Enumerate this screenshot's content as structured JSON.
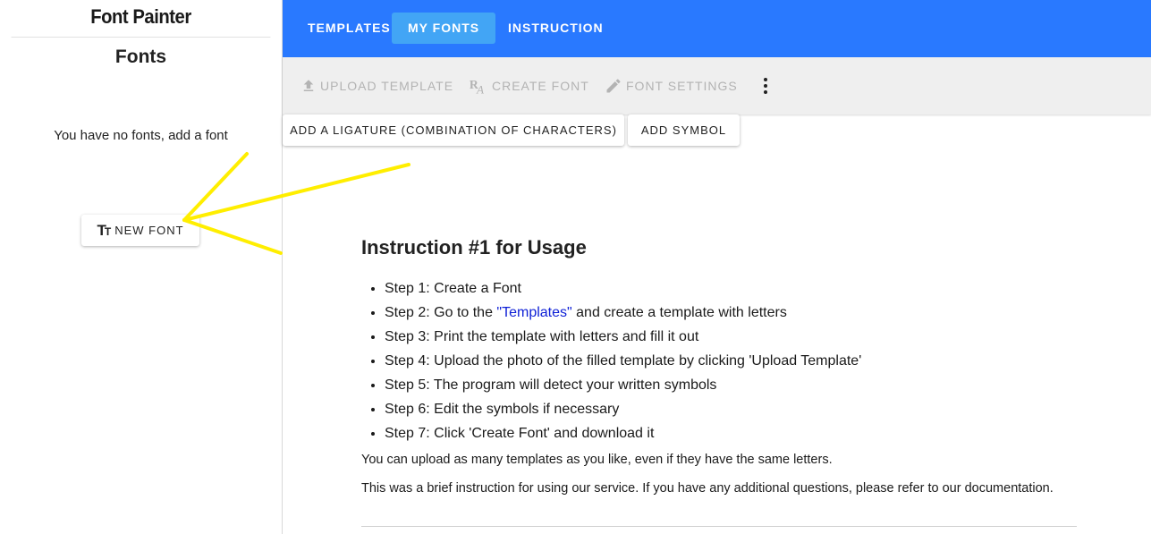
{
  "app": {
    "title": "Font Painter"
  },
  "sidebar": {
    "heading": "Fonts",
    "empty_message": "You have no fonts, add a font",
    "new_font_label": "NEW FONT",
    "new_font_icon": "text-size-icon"
  },
  "nav": {
    "tabs": [
      {
        "label": "TEMPLATES",
        "active": false
      },
      {
        "label": "MY FONTS",
        "active": true
      },
      {
        "label": "INSTRUCTION",
        "active": false
      }
    ],
    "color": "#2979ff",
    "active_color": "#42a5f5"
  },
  "toolbar": {
    "upload_template": "UPLOAD TEMPLATE",
    "create_font": "CREATE FONT",
    "font_settings": "FONT SETTINGS",
    "icons": [
      "upload-icon",
      "font-glyph-icon",
      "pencil-icon",
      "more-vert-icon"
    ]
  },
  "actions": {
    "add_ligature": "ADD A LIGATURE (COMBINATION OF CHARACTERS)",
    "add_symbol": "ADD SYMBOL"
  },
  "instruction": {
    "title": "Instruction #1 for Usage",
    "step2_prefix": "Step 2: Go to the ",
    "step2_link": "\"Templates\"",
    "step2_suffix": " and create a template with letters",
    "steps": [
      "Step 1: Create a Font",
      "Step 3: Print the template with letters and fill it out",
      "Step 4: Upload the photo of the filled template by clicking 'Upload Template'",
      "Step 5: The program will detect your written symbols",
      "Step 6: Edit the symbols if necessary",
      "Step 7: Click 'Create Font' and download it"
    ],
    "note_1": "You can upload as many templates as you like, even if they have the same letters.",
    "note_2": "This was a brief instruction for using our service. If you have any additional questions, please refer to our documentation."
  },
  "annotation": {
    "color": "#ffee00"
  }
}
